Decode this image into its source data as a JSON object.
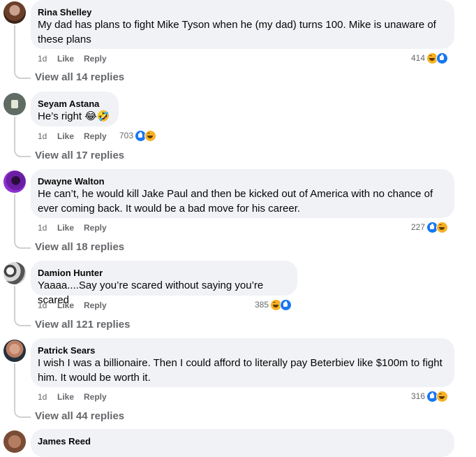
{
  "comments": [
    {
      "name": "Rina Shelley",
      "text_lines": [
        "My dad has plans to fight Mike Tyson when he (my dad) turns 100. Mike is unaware of",
        "these plans"
      ],
      "time": "1d",
      "like": "Like",
      "reply": "Reply",
      "reaction_count": "414",
      "reactions": [
        "haha-icon",
        "like-icon"
      ],
      "view_replies": "View all 14 replies"
    },
    {
      "name": "Seyam Astana",
      "text_lines": [
        "He’s right 😂🤣"
      ],
      "time": "1d",
      "like": "Like",
      "reply": "Reply",
      "reaction_count": "703",
      "reactions": [
        "like-icon",
        "haha-icon"
      ],
      "view_replies": "View all 17 replies"
    },
    {
      "name": "Dwayne Walton",
      "text_lines": [
        "He can’t, he would kill Jake Paul and then be kicked out of America with no chance of",
        "ever coming back. It would be a bad move for his career."
      ],
      "time": "1d",
      "like": "Like",
      "reply": "Reply",
      "reaction_count": "227",
      "reactions": [
        "like-icon",
        "haha-icon"
      ],
      "view_replies": "View all 18 replies"
    },
    {
      "name": "Damion Hunter",
      "text_lines": [
        "Yaaaa....Say you’re scared without saying you’re scared"
      ],
      "time": "1d",
      "like": "Like",
      "reply": "Reply",
      "reaction_count": "385",
      "reactions": [
        "haha-icon",
        "like-icon"
      ],
      "view_replies": "View all 121 replies"
    },
    {
      "name": "Patrick Sears",
      "text_lines": [
        "I wish I was a billionaire. Then I could afford to literally pay Beterbiev like $100m to fight",
        "him. It would be worth it."
      ],
      "time": "1d",
      "like": "Like",
      "reply": "Reply",
      "reaction_count": "316",
      "reactions": [
        "like-icon",
        "haha-icon"
      ],
      "view_replies": "View all 44 replies"
    },
    {
      "name": "James Reed"
    }
  ]
}
